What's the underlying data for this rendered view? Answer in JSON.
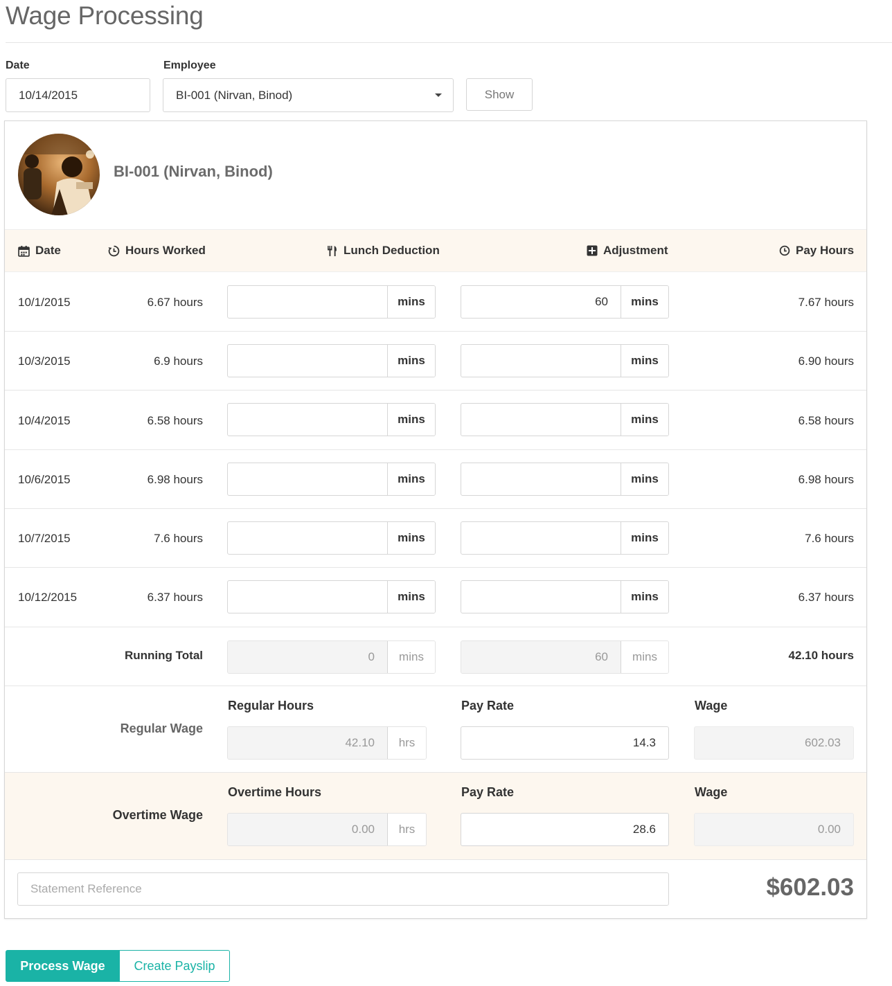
{
  "page_title": "Wage Processing",
  "filters": {
    "date_label": "Date",
    "date_value": "10/14/2015",
    "employee_label": "Employee",
    "employee_value": "BI-001 (Nirvan, Binod)",
    "show_button": "Show"
  },
  "employee": {
    "name": "BI-001 (Nirvan, Binod)"
  },
  "table": {
    "headers": {
      "date": "Date",
      "hours_worked": "Hours Worked",
      "lunch_deduction": "Lunch Deduction",
      "adjustment": "Adjustment",
      "pay_hours": "Pay Hours"
    },
    "unit_mins": "mins",
    "rows": [
      {
        "date": "10/1/2015",
        "hours_worked": "6.67 hours",
        "lunch": "",
        "adjustment": "60",
        "pay_hours": "7.67 hours"
      },
      {
        "date": "10/3/2015",
        "hours_worked": "6.9 hours",
        "lunch": "",
        "adjustment": "",
        "pay_hours": "6.90 hours"
      },
      {
        "date": "10/4/2015",
        "hours_worked": "6.58 hours",
        "lunch": "",
        "adjustment": "",
        "pay_hours": "6.58 hours"
      },
      {
        "date": "10/6/2015",
        "hours_worked": "6.98 hours",
        "lunch": "",
        "adjustment": "",
        "pay_hours": "6.98 hours"
      },
      {
        "date": "10/7/2015",
        "hours_worked": "7.6 hours",
        "lunch": "",
        "adjustment": "",
        "pay_hours": "7.6 hours"
      },
      {
        "date": "10/12/2015",
        "hours_worked": "6.37 hours",
        "lunch": "",
        "adjustment": "",
        "pay_hours": "6.37 hours"
      }
    ],
    "running_total": {
      "label": "Running Total",
      "lunch": "0",
      "adjustment": "60",
      "pay_hours": "42.10 hours"
    }
  },
  "regular": {
    "label": "Regular Wage",
    "hours_label": "Regular Hours",
    "hours_value": "42.10",
    "hours_unit": "hrs",
    "rate_label": "Pay Rate",
    "rate_value": "14.3",
    "wage_label": "Wage",
    "wage_value": "602.03"
  },
  "overtime": {
    "label": "Overtime Wage",
    "hours_label": "Overtime Hours",
    "hours_value": "0.00",
    "hours_unit": "hrs",
    "rate_label": "Pay Rate",
    "rate_value": "28.6",
    "wage_label": "Wage",
    "wage_value": "0.00"
  },
  "statement_placeholder": "Statement Reference",
  "total": "$602.03",
  "actions": {
    "process": "Process Wage",
    "payslip": "Create Payslip"
  },
  "colors": {
    "accent": "#1ab3a6",
    "header_band": "#fdf7ef"
  }
}
